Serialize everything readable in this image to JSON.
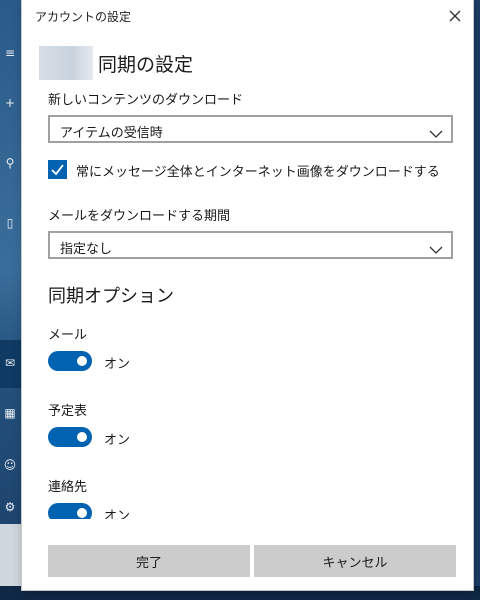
{
  "window": {
    "title": "アカウントの設定"
  },
  "header": {
    "title": "同期の設定"
  },
  "download_content": {
    "label": "新しいコンテンツのダウンロード",
    "selected": "アイテムの受信時"
  },
  "full_message_checkbox": {
    "label": "常にメッセージ全体とインターネット画像をダウンロードする",
    "checked": true
  },
  "download_period": {
    "label": "メールをダウンロードする期間",
    "selected": "指定なし"
  },
  "sync_options": {
    "title": "同期オプション",
    "items": [
      {
        "label": "メール",
        "state": "オン",
        "on": true
      },
      {
        "label": "予定表",
        "state": "オン",
        "on": true
      },
      {
        "label": "連絡先",
        "state": "オン",
        "on": true
      }
    ]
  },
  "footer": {
    "done_label": "完了",
    "cancel_label": "キャンセル"
  },
  "colors": {
    "accent": "#0063b1",
    "button_bg": "#cccccc"
  }
}
